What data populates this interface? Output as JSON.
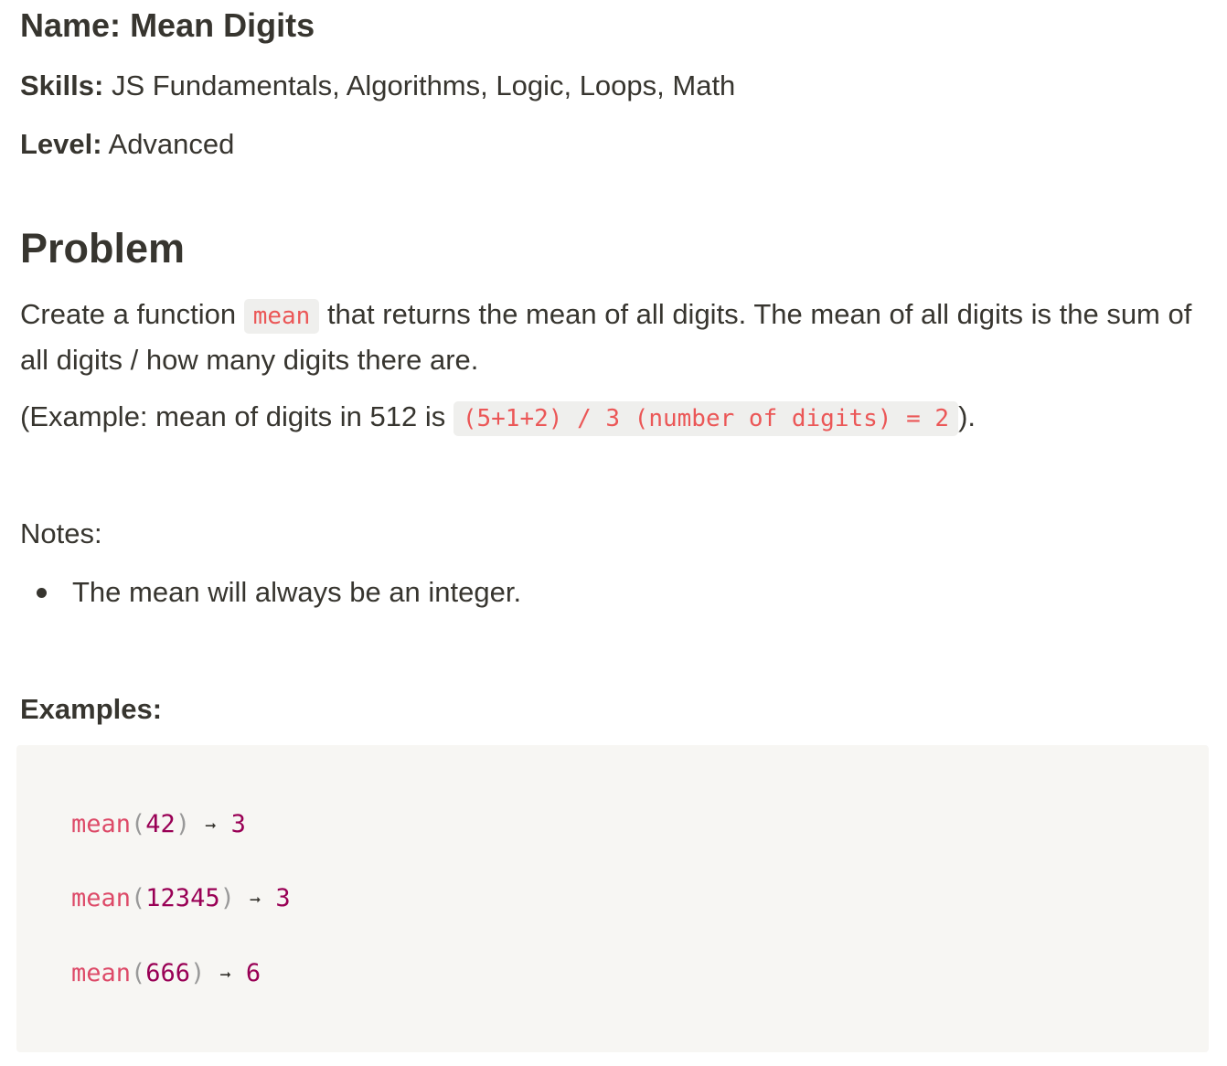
{
  "header": {
    "name_label": "Name:",
    "name_value": "Mean Digits",
    "skills_label": "Skills:",
    "skills_value": "JS Fundamentals, Algorithms, Logic, Loops, Math",
    "level_label": "Level:",
    "level_value": "Advanced"
  },
  "problem": {
    "heading": "Problem",
    "p1_before": "Create a function ",
    "p1_code": "mean",
    "p1_after": " that returns the mean of all digits. The mean of all digits is the sum of all digits / how many digits there are.",
    "p2_before": "(Example: mean of digits in 512 is ",
    "p2_code": "(5+1+2) / 3 (number of digits) = 2",
    "p2_after": ")."
  },
  "notes": {
    "label": "Notes:",
    "items": [
      "The mean will always be an integer."
    ]
  },
  "examples": {
    "label": "Examples:",
    "lines": [
      {
        "fn": "mean",
        "open": "(",
        "arg": "42",
        "close": ")",
        "arrow": "➞",
        "result": "3"
      },
      {
        "fn": "mean",
        "open": "(",
        "arg": "12345",
        "close": ")",
        "arrow": "➞",
        "result": "3"
      },
      {
        "fn": "mean",
        "open": "(",
        "arg": "666",
        "close": ")",
        "arrow": "➞",
        "result": "6"
      }
    ]
  },
  "colors": {
    "text": "#37352f",
    "inline_code": "#eb5757",
    "inline_code_bg": "#efefed",
    "code_block_bg": "#f7f6f3",
    "token_function": "#dd4a68",
    "token_number": "#990055",
    "token_punctuation": "#999999"
  }
}
